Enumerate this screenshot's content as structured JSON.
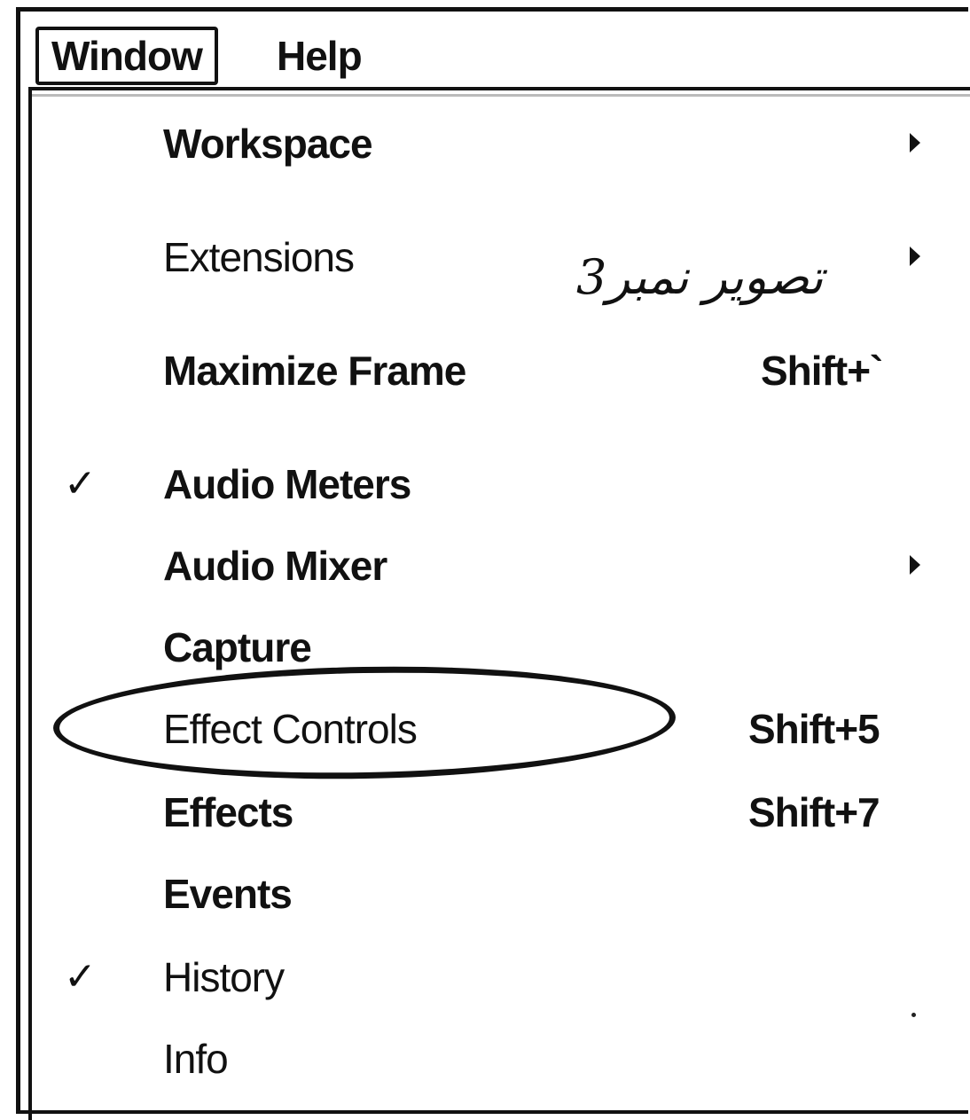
{
  "menubar": {
    "items": [
      {
        "label": "Window"
      },
      {
        "label": "Help"
      }
    ]
  },
  "window_menu": {
    "items": [
      {
        "label": "Workspace",
        "shortcut": "",
        "checked": false,
        "submenu": true
      },
      {
        "label": "Extensions",
        "shortcut": "",
        "checked": false,
        "submenu": true
      },
      {
        "label": "Maximize Frame",
        "shortcut": "Shift+`",
        "checked": false,
        "submenu": false
      },
      {
        "label": "Audio Meters",
        "shortcut": "",
        "checked": true,
        "submenu": false
      },
      {
        "label": "Audio Mixer",
        "shortcut": "",
        "checked": false,
        "submenu": true
      },
      {
        "label": "Capture",
        "shortcut": "",
        "checked": false,
        "submenu": false
      },
      {
        "label": "Effect Controls",
        "shortcut": "Shift+5",
        "checked": false,
        "submenu": false
      },
      {
        "label": "Effects",
        "shortcut": "Shift+7",
        "checked": false,
        "submenu": false
      },
      {
        "label": "Events",
        "shortcut": "",
        "checked": false,
        "submenu": false
      },
      {
        "label": "History",
        "shortcut": "",
        "checked": true,
        "submenu": false
      },
      {
        "label": "Info",
        "shortcut": "",
        "checked": false,
        "submenu": false
      }
    ],
    "check_glyph": "✓"
  },
  "annotation": {
    "text": "تصویر نمبر3"
  },
  "colors": {
    "ink": "#111111",
    "background": "#ffffff"
  }
}
